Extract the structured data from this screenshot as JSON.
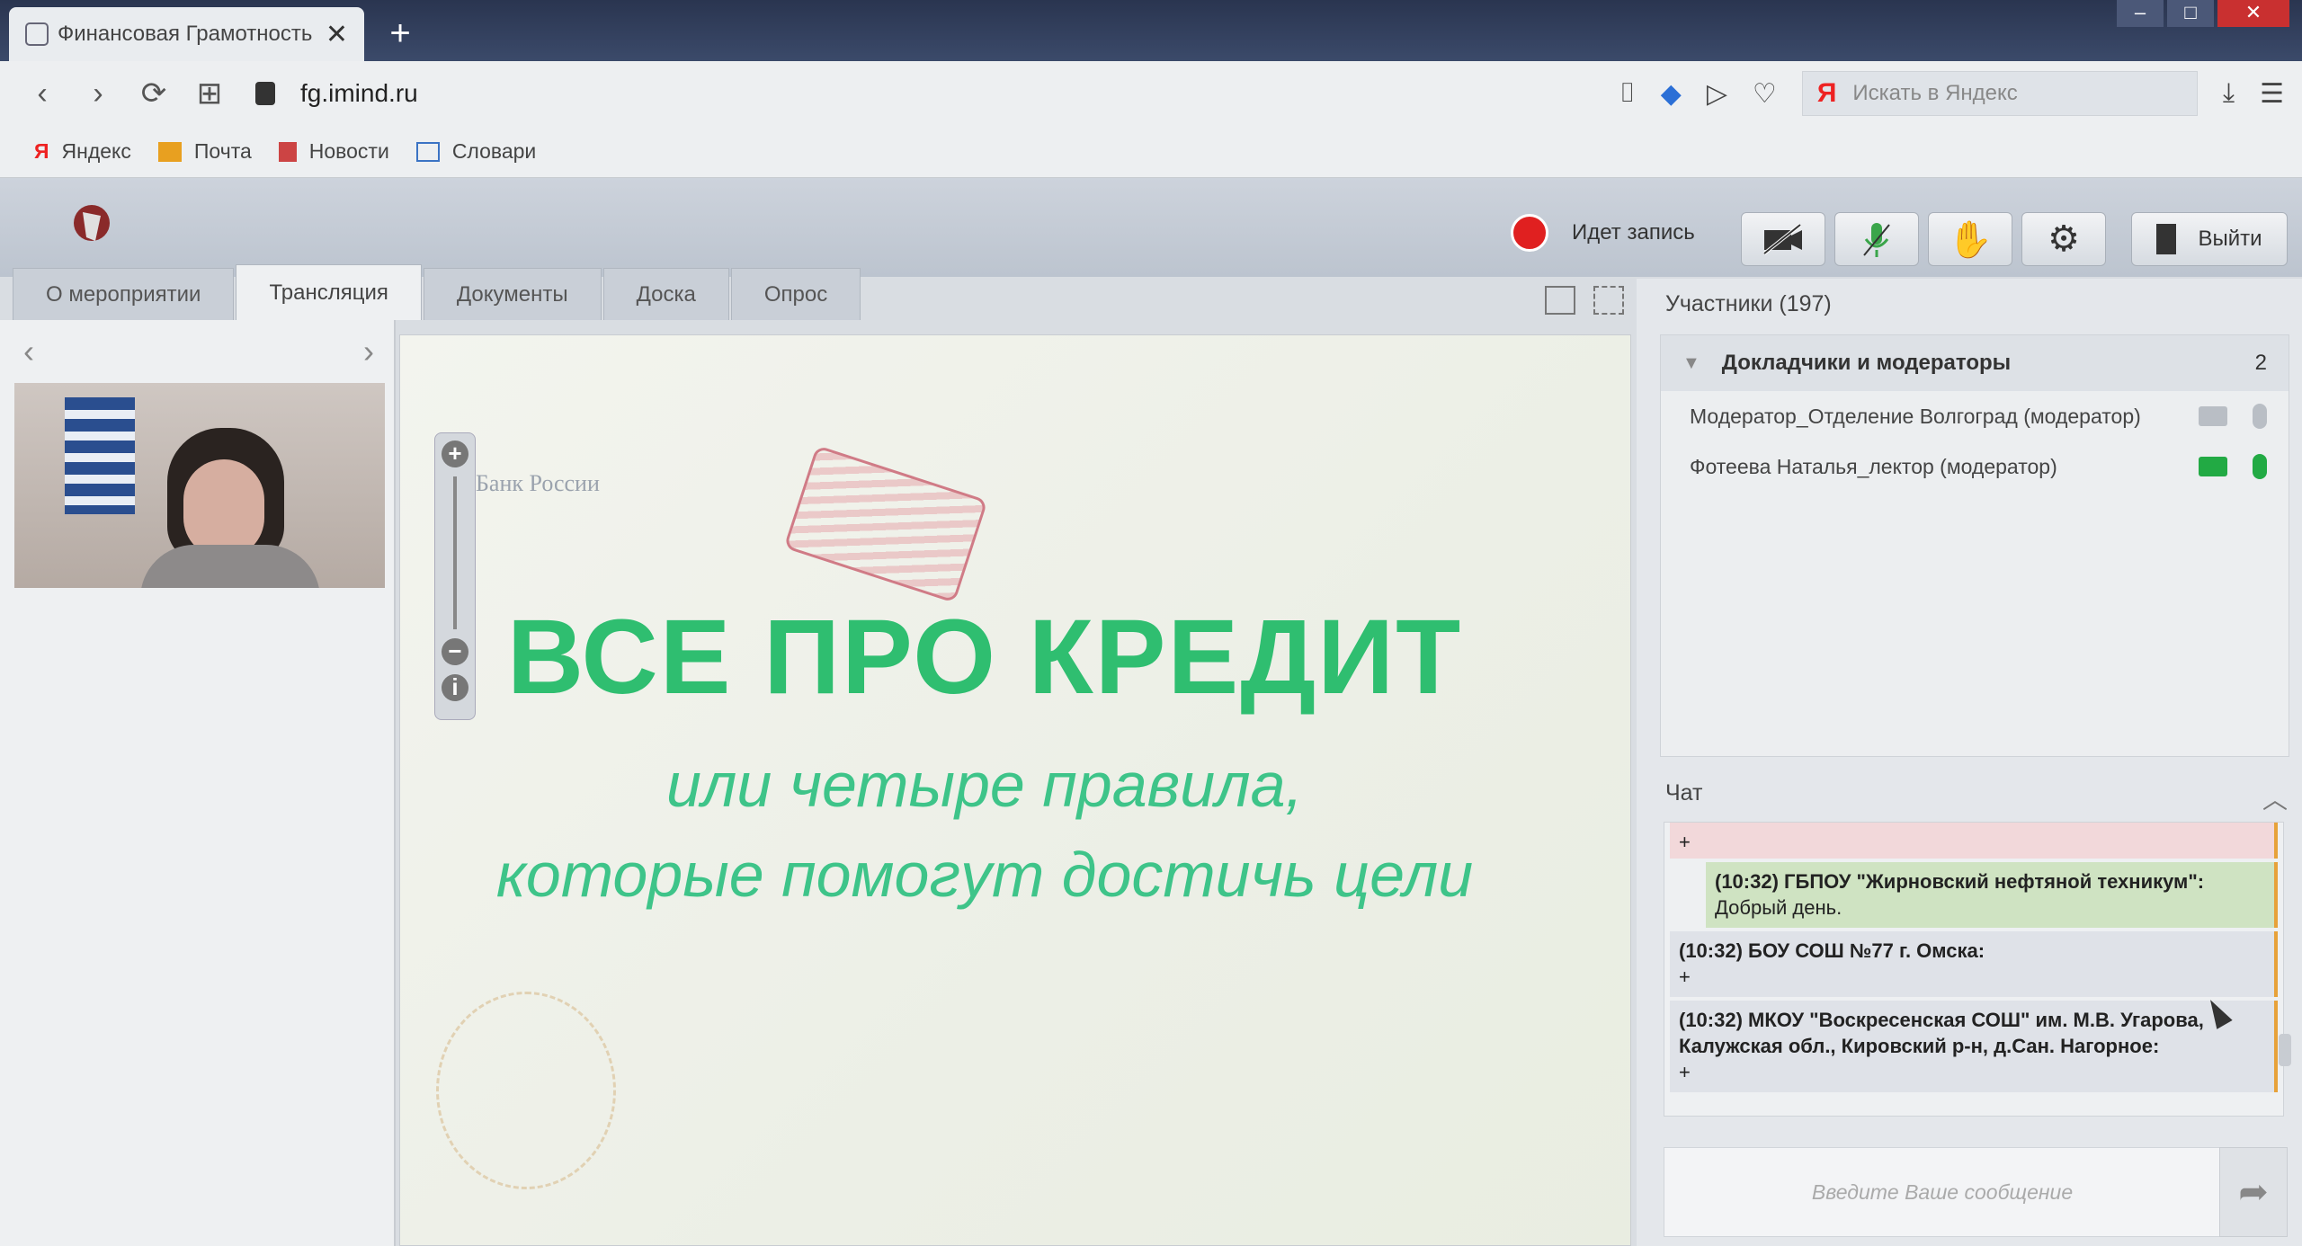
{
  "browser": {
    "tab_title": "Финансовая Грамотность",
    "url": "fg.imind.ru",
    "search_placeholder": "Искать в Яндекс",
    "bookmarks": [
      "Яндекс",
      "Почта",
      "Новости",
      "Словари"
    ]
  },
  "header": {
    "recording_label": "Идет запись",
    "exit_label": "Выйти"
  },
  "tabs": [
    "О мероприятии",
    "Трансляция",
    "Документы",
    "Доска",
    "Опрос"
  ],
  "slide": {
    "bank_label": "Банк России",
    "title": "ВСЕ ПРО КРЕДИТ",
    "subtitle_line1": "или четыре правила,",
    "subtitle_line2": "которые помогут достичь цели"
  },
  "participants": {
    "title": "Участники (197)",
    "group_name": "Докладчики и модераторы",
    "group_count": "2",
    "people": [
      {
        "name": "Модератор_Отделение Волгоград (модератор)",
        "camera": "off",
        "mic": "off"
      },
      {
        "name": "Фотеева Наталья_лектор (модератор)",
        "camera": "on",
        "mic": "on"
      }
    ]
  },
  "chat": {
    "title": "Чат",
    "messages": [
      {
        "header": "",
        "text": "+"
      },
      {
        "header": "(10:32) ГБПОУ \"Жирновский нефтяной техникум\":",
        "text": "Добрый день."
      },
      {
        "header": "(10:32) БОУ СОШ №77 г. Омска:",
        "text": "+"
      },
      {
        "header": "(10:32) МКОУ \"Воскресенская СОШ\" им. М.В. Угарова, Калужская обл., Кировский р-н, д.Сан. Нагорное:",
        "text": "+"
      }
    ],
    "input_placeholder": "Введите Ваше сообщение"
  },
  "colors": {
    "slide_green": "#2fbe70",
    "record_red": "#e02020",
    "cam_on": "#22aa44"
  }
}
